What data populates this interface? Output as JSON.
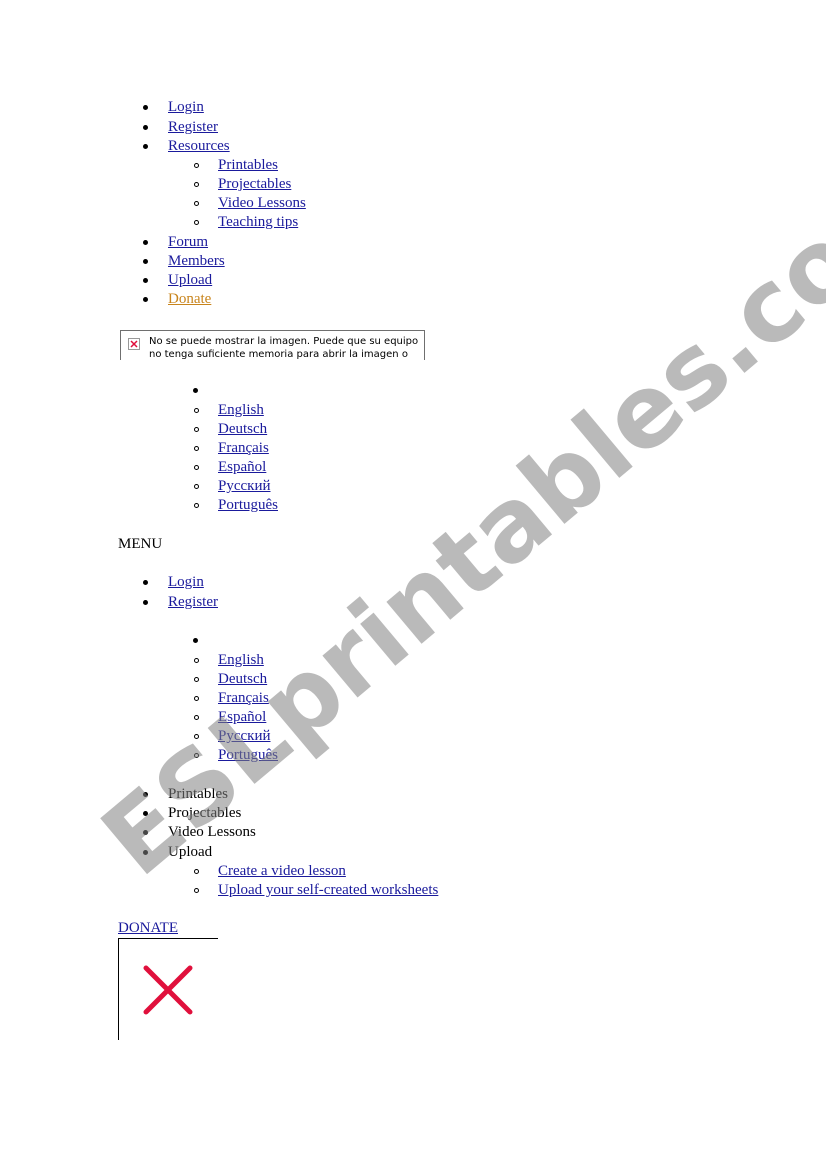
{
  "top_nav": {
    "login": "Login",
    "register": "Register",
    "resources": "Resources",
    "resources_items": [
      "Printables",
      "Projectables",
      "Video Lessons",
      "Teaching tips"
    ],
    "forum": "Forum",
    "members": "Members",
    "upload": "Upload",
    "donate": "Donate"
  },
  "broken_image": {
    "message": "No se puede mostrar la imagen. Puede que su equipo no tenga suficiente memoria para abrir la imagen o que ést"
  },
  "languages_1": [
    "English",
    "Deutsch",
    "Français",
    "Español",
    "Русский",
    "Português"
  ],
  "menu_heading": "MENU",
  "menu": {
    "login": "Login",
    "register": "Register"
  },
  "languages_2": [
    "English",
    "Deutsch",
    "Français",
    "Español",
    "Русский",
    "Português"
  ],
  "sections": [
    "Printables",
    "Projectables",
    "Video Lessons",
    "Upload"
  ],
  "upload_items": [
    "Create a video lesson",
    "Upload your self-created worksheets"
  ],
  "donate_link": "DONATE",
  "watermark": "ESLprintables.com",
  "colors": {
    "link": "#1a1a9c",
    "donate": "#c8841c",
    "broken_x": "#e0103c",
    "watermark": "#828282"
  }
}
